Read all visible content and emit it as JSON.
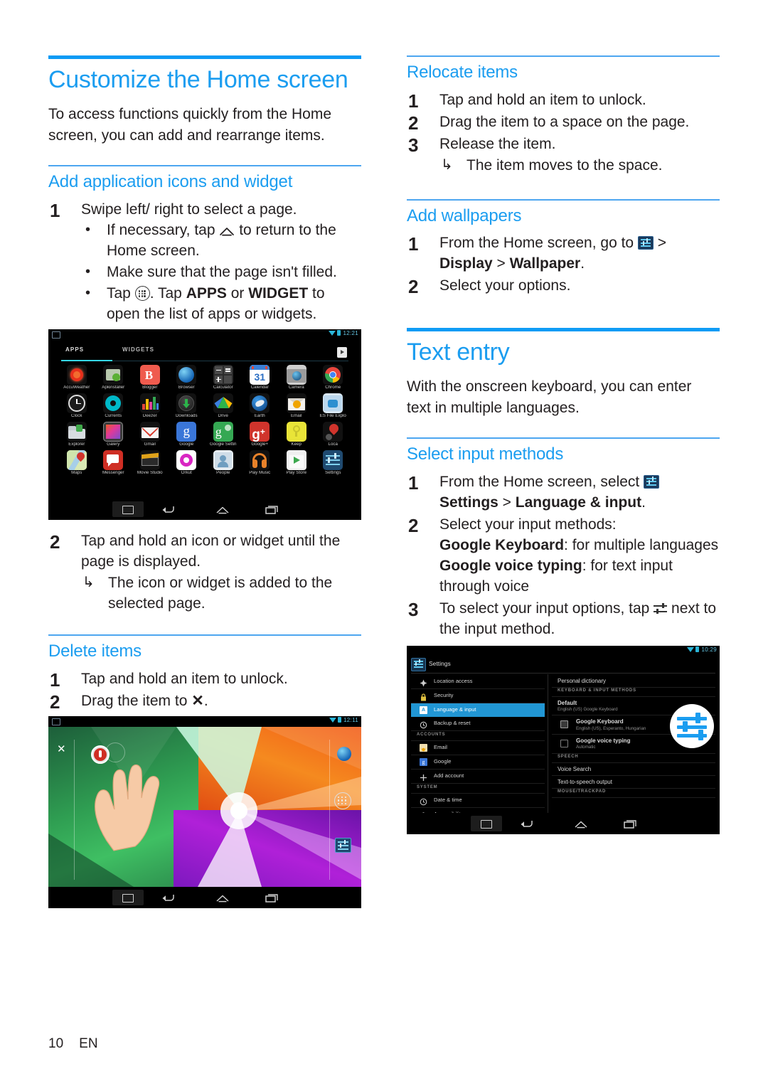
{
  "page": {
    "number": "10",
    "language_code": "EN"
  },
  "left_column": {
    "main_heading": "Customize the Home screen",
    "intro": "To access functions quickly from the Home screen, you can add and rearrange items.",
    "section_add": {
      "heading": "Add application icons and widget",
      "step1": {
        "num": "1",
        "text": "Swipe left/ right to select a page.",
        "bullets": [
          {
            "pre": "If necessary, tap ",
            "icon": "home-icon",
            "post": " to return to the Home screen."
          },
          {
            "pre": "Make sure that the page isn't filled.",
            "icon": "",
            "post": ""
          },
          {
            "pre": "Tap ",
            "icon": "apps-grid-icon",
            "post": " . Tap APPS or WIDGET to open the list of apps or widgets."
          }
        ],
        "bullet3_tap": "Tap",
        "bullet3_mid": ". Tap ",
        "bullet3_apps": "APPS",
        "bullet3_or": " or ",
        "bullet3_widget": "WIDGET",
        "bullet3_end": " to open the list of apps or widgets."
      },
      "step2": {
        "num": "2",
        "text": "Tap and hold an icon or widget until the page is displayed.",
        "result": "The icon or widget is added to the selected page."
      }
    },
    "section_delete": {
      "heading": "Delete items",
      "steps": [
        {
          "num": "1",
          "text": "Tap and hold an item to unlock."
        },
        {
          "num": "2",
          "text": "Drag the item to ",
          "icon": "close-x-icon",
          "post": "."
        }
      ]
    }
  },
  "right_column": {
    "section_relocate": {
      "heading": "Relocate items",
      "steps": [
        {
          "num": "1",
          "text": "Tap and hold an item to unlock."
        },
        {
          "num": "2",
          "text": "Drag the item to a space on the page."
        },
        {
          "num": "3",
          "text": "Release the item."
        }
      ],
      "result": "The item moves to the space."
    },
    "section_wallpapers": {
      "heading": "Add wallpapers",
      "step1_pre": "From the Home screen, go to ",
      "step1_icon": "settings-icon",
      "step1_mid": " > ",
      "step1_display": "Display",
      "step1_gt": " > ",
      "step1_wallpaper": "Wallpaper",
      "step1_end": ".",
      "step1_num": "1",
      "step2_num": "2",
      "step2_text": "Select your options."
    },
    "section_text_entry": {
      "heading": "Text entry",
      "intro": "With the onscreen keyboard, you can enter text in multiple languages."
    },
    "section_input_methods": {
      "heading": "Select input methods",
      "step1_num": "1",
      "step1_pre": "From the Home screen, select ",
      "step1_icon": "settings-icon",
      "step1_settings": "Settings",
      "step1_gt": " > ",
      "step1_lang": "Language & input",
      "step1_end": ".",
      "step2_num": "2",
      "step2_text": "Select your input methods:",
      "step2_kb_label": "Google Keyboard",
      "step2_kb_desc": ": for multiple languages",
      "step2_voice_label": "Google voice typing",
      "step2_voice_desc": ": for text input through voice",
      "step3_num": "3",
      "step3_pre": "To select your input options, tap ",
      "step3_icon": "sliders-icon",
      "step3_post": " next to the input method."
    }
  },
  "screenshot_app_drawer": {
    "status_time": "12:21",
    "tabs": [
      {
        "label": "APPS",
        "selected": true
      },
      {
        "label": "WIDGETS",
        "selected": false
      }
    ],
    "play_store_icon": "play-store-icon",
    "apps": [
      {
        "label": "AccuWeather",
        "icon": "accuweather-icon"
      },
      {
        "label": "Apkinstaller",
        "icon": "apkinstaller-icon"
      },
      {
        "label": "Blogger",
        "icon": "blogger-icon"
      },
      {
        "label": "Browser",
        "icon": "browser-icon"
      },
      {
        "label": "Calculator",
        "icon": "calculator-icon"
      },
      {
        "label": "Calendar",
        "icon": "calendar-icon"
      },
      {
        "label": "Camera",
        "icon": "camera-icon"
      },
      {
        "label": "Chrome",
        "icon": "chrome-icon"
      },
      {
        "label": "Clock",
        "icon": "clock-icon"
      },
      {
        "label": "Currents",
        "icon": "currents-icon"
      },
      {
        "label": "Deezer",
        "icon": "deezer-icon"
      },
      {
        "label": "Downloads",
        "icon": "downloads-icon"
      },
      {
        "label": "Drive",
        "icon": "drive-icon"
      },
      {
        "label": "Earth",
        "icon": "earth-icon"
      },
      {
        "label": "Email",
        "icon": "email-icon"
      },
      {
        "label": "ES File Explo",
        "icon": "es-file-explorer-icon"
      },
      {
        "label": "Explorer",
        "icon": "explorer-icon"
      },
      {
        "label": "Galery",
        "icon": "gallery-icon"
      },
      {
        "label": "Gmail",
        "icon": "gmail-icon"
      },
      {
        "label": "Google",
        "icon": "google-icon"
      },
      {
        "label": "Google Settin",
        "icon": "google-settings-icon"
      },
      {
        "label": "Google+",
        "icon": "google-plus-icon"
      },
      {
        "label": "Keep",
        "icon": "keep-icon"
      },
      {
        "label": "Loca",
        "icon": "local-icon"
      },
      {
        "label": "Maps",
        "icon": "maps-icon"
      },
      {
        "label": "Messenger",
        "icon": "messenger-icon"
      },
      {
        "label": "Movie Studio",
        "icon": "movie-studio-icon"
      },
      {
        "label": "Orkut",
        "icon": "orkut-icon"
      },
      {
        "label": "People",
        "icon": "people-icon"
      },
      {
        "label": "Play Music",
        "icon": "play-music-icon"
      },
      {
        "label": "Play Store",
        "icon": "play-store-icon"
      },
      {
        "label": "Settings",
        "icon": "settings-app-icon"
      }
    ],
    "nav": [
      "screenshot-icon",
      "back-icon",
      "home-icon",
      "recents-icon"
    ]
  },
  "screenshot_home": {
    "status_time": "12:11",
    "delete_target": "✕",
    "dock_icons": [
      "browser-icon",
      "apps-grid-icon",
      "settings-icon"
    ],
    "nav": [
      "screenshot-icon",
      "back-icon",
      "home-icon",
      "recents-icon"
    ]
  },
  "screenshot_settings": {
    "status_time": "10:29",
    "title": "Settings",
    "sidebar": [
      {
        "label": "Location access",
        "icon": "location-icon",
        "selected": false
      },
      {
        "label": "Security",
        "icon": "lock-icon",
        "selected": false
      },
      {
        "label": "Language & input",
        "icon": "language-icon",
        "selected": true
      },
      {
        "label": "Backup & reset",
        "icon": "backup-icon",
        "selected": false
      },
      {
        "label": "ACCOUNTS",
        "type": "header"
      },
      {
        "label": "Email",
        "icon": "email-icon",
        "selected": false
      },
      {
        "label": "Google",
        "icon": "google-icon",
        "selected": false
      },
      {
        "label": "Add account",
        "icon": "plus-icon",
        "selected": false
      },
      {
        "label": "SYSTEM",
        "type": "header"
      },
      {
        "label": "Date & time",
        "icon": "clock-icon",
        "selected": false
      },
      {
        "label": "Accessibility",
        "icon": "accessibility-icon",
        "selected": false
      }
    ],
    "detail": [
      {
        "type": "row",
        "title": "Personal dictionary",
        "sub": ""
      },
      {
        "type": "header",
        "title": "KEYBOARD & INPUT METHODS"
      },
      {
        "type": "row",
        "title": "Default",
        "sub": "English (US)   Google Keyboard"
      },
      {
        "type": "check",
        "title": "Google Keyboard",
        "sub": "English (US), Esperanto, Hungarian",
        "checked": true
      },
      {
        "type": "check",
        "title": "Google voice typing",
        "sub": "Automatic",
        "checked": false
      },
      {
        "type": "header",
        "title": "SPEECH"
      },
      {
        "type": "row",
        "title": "Voice Search",
        "sub": ""
      },
      {
        "type": "row",
        "title": "Text-to-speech output",
        "sub": ""
      },
      {
        "type": "header",
        "title": "MOUSE/TRACKPAD"
      }
    ],
    "callout_icon": "sliders-icon",
    "nav": [
      "screenshot-icon",
      "back-icon",
      "home-icon",
      "recents-icon"
    ]
  },
  "colors": {
    "accent_blue": "#1b9df0",
    "rule_thick": "#0d9bf5",
    "rule_thin": "#4da6f0",
    "text": "#231f20",
    "settings_highlight": "#2196d4"
  }
}
